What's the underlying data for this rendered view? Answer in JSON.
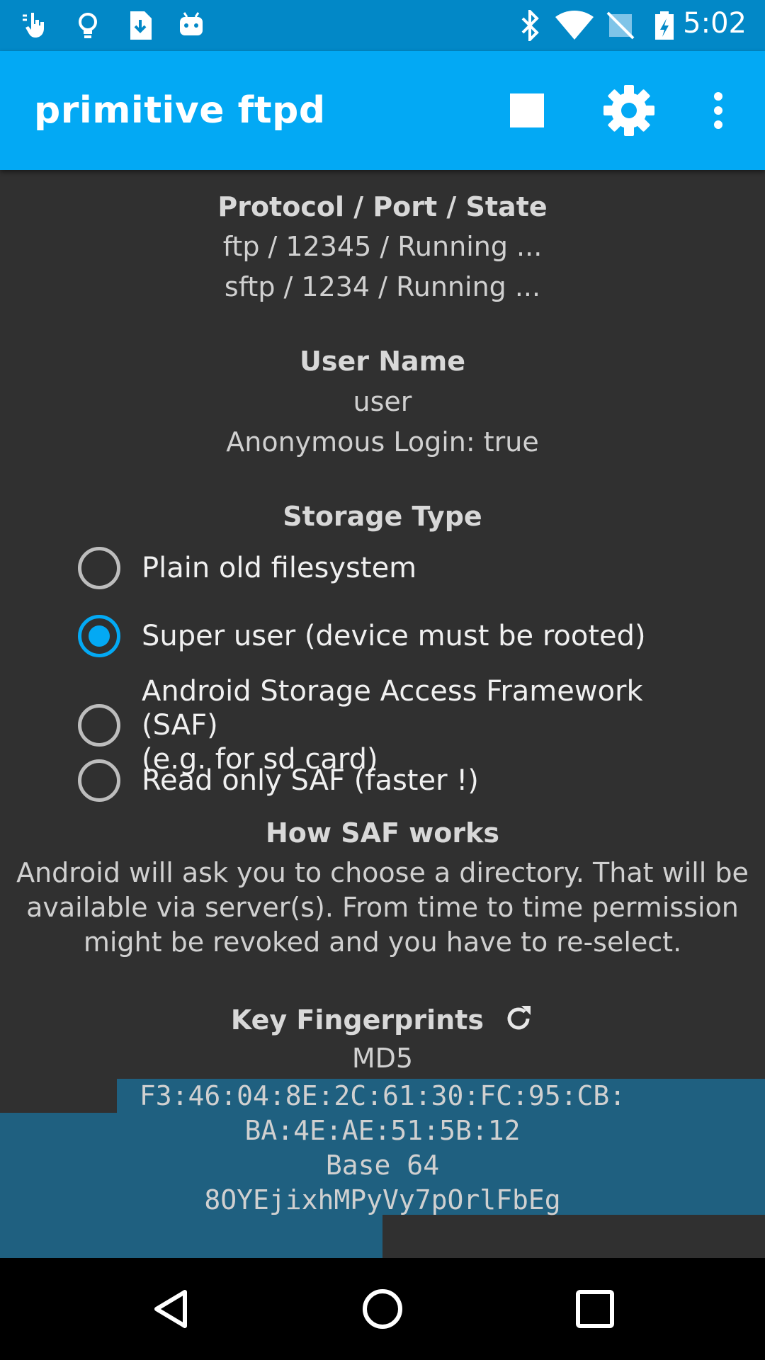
{
  "status_bar": {
    "time": "5:02",
    "left_icons": [
      "touch-icon",
      "lightbulb-icon",
      "file-download-icon",
      "android-icon"
    ],
    "right_icons": [
      "bluetooth-icon",
      "wifi-icon",
      "no-sim-icon",
      "battery-charging-icon"
    ]
  },
  "app_bar": {
    "title": "primitive ftpd",
    "actions": [
      "stop-icon",
      "settings-icon",
      "overflow-menu-icon"
    ]
  },
  "server": {
    "heading": "Protocol / Port / State",
    "ftp_line": "ftp / 12345 / Running ...",
    "sftp_line": "sftp / 1234 / Running ..."
  },
  "user": {
    "heading": "User Name",
    "name": "user",
    "anonymous": "Anonymous Login: true"
  },
  "storage": {
    "heading": "Storage Type",
    "options": [
      {
        "label": "Plain old filesystem",
        "checked": false
      },
      {
        "label": "Super user (device must be rooted)",
        "checked": true
      },
      {
        "label_line1": "Android Storage Access Framework (SAF)",
        "label_line2": "(e.g. for sd card)",
        "checked": false
      },
      {
        "label": "Read only SAF (faster !)",
        "checked": false
      }
    ]
  },
  "saf": {
    "heading": "How SAF works",
    "line1": "Android will ask you to choose a directory. That will be",
    "line2": "available via server(s). From time to time permission",
    "line3": "might be revoked and you have to re-select."
  },
  "fingerprints": {
    "heading": "Key Fingerprints",
    "md5_label": "MD5",
    "md5_line1": "F3:46:04:8E:2C:61:30:FC:95:CB:",
    "md5_line2": "BA:4E:AE:51:5B:12",
    "base64_label": "Base 64",
    "base64_value": "8OYEjixhMPyVy7pOrlFbEg"
  },
  "nav_bar": {
    "buttons": [
      "back-icon",
      "home-icon",
      "recents-icon"
    ]
  },
  "colors": {
    "status_bar": "#0288c7",
    "app_bar": "#03a9f4",
    "background": "#303030",
    "accent": "#03a9f4",
    "selection": "#1f6080"
  }
}
